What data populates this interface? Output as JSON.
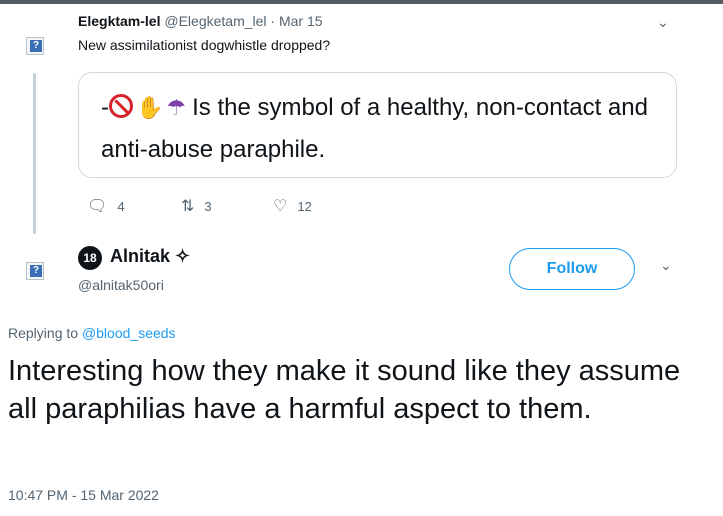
{
  "tweet1": {
    "author_name": "Elegktam-lel",
    "author_handle": "@Elegketam_lel",
    "separator": "·",
    "date": "Mar 15",
    "text": "New assimilationist dogwhistle dropped?",
    "quote": {
      "prefix": "-",
      "text": "Is the symbol of a healthy, non-contact and anti-abuse paraphile."
    },
    "actions": {
      "replies": "4",
      "retweets": "3",
      "likes": "12"
    }
  },
  "tweet2": {
    "avatar_text": "18",
    "author_name": "Alnitak",
    "author_symbol": "✧",
    "author_handle": "@alnitak50ori",
    "follow_label": "Follow",
    "replying_prefix": "Replying to",
    "replying_to": "@blood_seeds",
    "text": "Interesting how they make it sound like they assume all paraphilias have a harmful aspect to them.",
    "timestamp": "10:47 PM - 15 Mar 2022"
  },
  "icons": {
    "reply": "speech-bubble",
    "retweet": "retweet-arrows",
    "like": "heart",
    "more": "chevron-down"
  },
  "colors": {
    "link": "#1d9bf0",
    "muted": "#536471",
    "text": "#0f1419"
  }
}
